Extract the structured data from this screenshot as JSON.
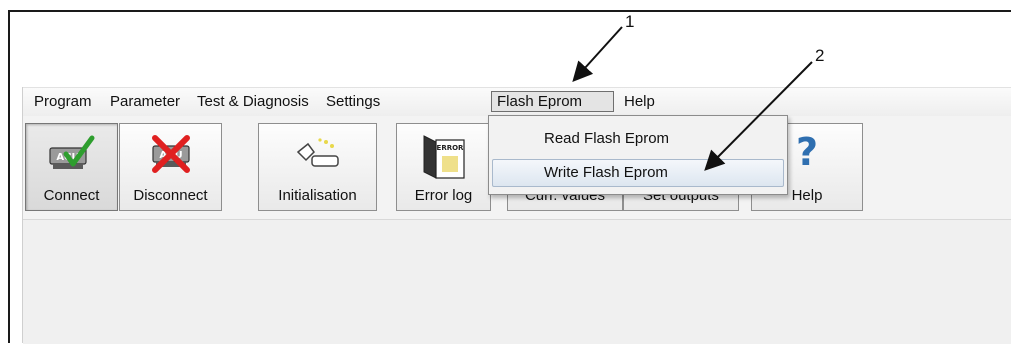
{
  "menubar": {
    "items": [
      {
        "label": "Program"
      },
      {
        "label": "Parameter"
      },
      {
        "label": "Test & Diagnosis"
      },
      {
        "label": "Settings"
      },
      {
        "label": "Flash Eprom"
      },
      {
        "label": "Help"
      }
    ]
  },
  "toolbar": {
    "connect_label": "Connect",
    "disconnect_label": "Disconnect",
    "initialisation_label": "Initialisation",
    "errorlog_label": "Error log",
    "currvalues_label": "Curr. values",
    "setoutputs_label": "Set outputs",
    "help_label": "Help",
    "acu_text": "ACU",
    "error_text": "ERROR",
    "help_glyph": "?"
  },
  "dropdown": {
    "items": [
      {
        "label": "Read Flash Eprom"
      },
      {
        "label": "Write Flash Eprom"
      }
    ]
  },
  "callouts": {
    "one": "1",
    "two": "2"
  },
  "colors": {
    "check_green": "#2e9e2e",
    "cross_red": "#e02020",
    "help_blue": "#2f6fb0",
    "hover_blue": "#dde6f0"
  },
  "icons": [
    "acu-connect-icon",
    "acu-disconnect-icon",
    "initialisation-icon",
    "error-log-icon",
    "help-question-icon"
  ]
}
